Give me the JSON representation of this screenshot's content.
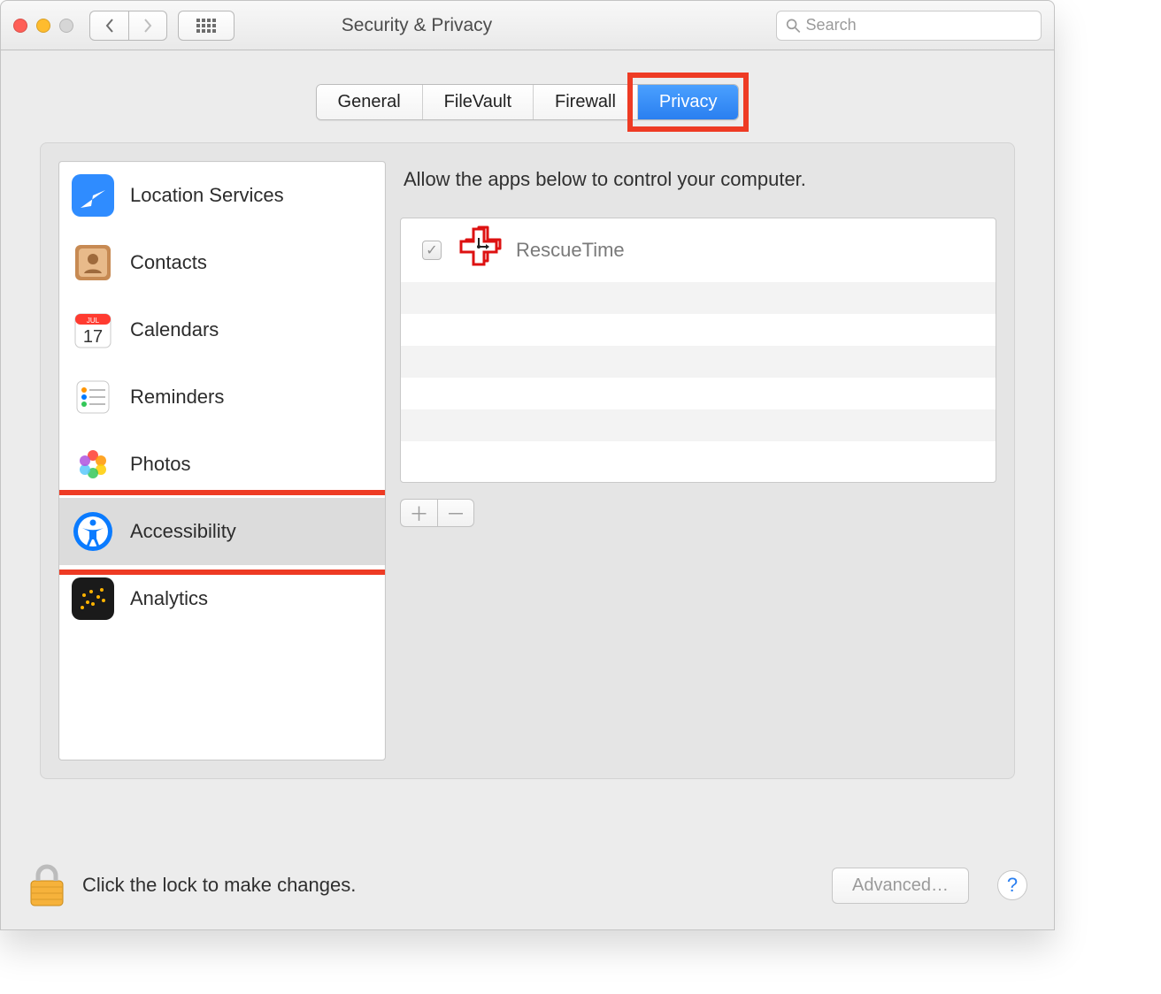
{
  "window": {
    "title": "Security & Privacy"
  },
  "search": {
    "placeholder": "Search"
  },
  "tabs": [
    {
      "label": "General",
      "active": false
    },
    {
      "label": "FileVault",
      "active": false
    },
    {
      "label": "Firewall",
      "active": false
    },
    {
      "label": "Privacy",
      "active": true
    }
  ],
  "sidebar": {
    "items": [
      {
        "label": "Location Services",
        "icon": "location-icon",
        "selected": false
      },
      {
        "label": "Contacts",
        "icon": "contacts-icon",
        "selected": false
      },
      {
        "label": "Calendars",
        "icon": "calendar-icon",
        "selected": false
      },
      {
        "label": "Reminders",
        "icon": "reminders-icon",
        "selected": false
      },
      {
        "label": "Photos",
        "icon": "photos-icon",
        "selected": false
      },
      {
        "label": "Accessibility",
        "icon": "accessibility-icon",
        "selected": true
      },
      {
        "label": "Analytics",
        "icon": "analytics-icon",
        "selected": false
      }
    ]
  },
  "detail": {
    "description": "Allow the apps below to control your computer.",
    "apps": [
      {
        "name": "RescueTime",
        "checked": true
      }
    ]
  },
  "footer": {
    "lock_text": "Click the lock to make changes.",
    "advanced_label": "Advanced…"
  },
  "highlights": {
    "tab_index": 3,
    "sidebar_index": 5
  }
}
